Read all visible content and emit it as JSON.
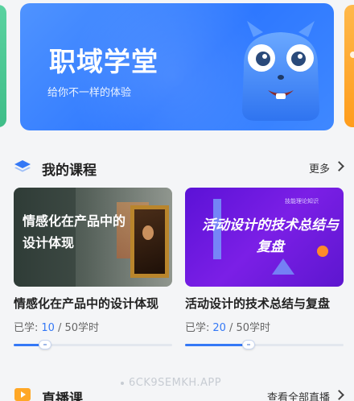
{
  "banner": {
    "title": "职域学堂",
    "subtitle": "给你不一样的体验"
  },
  "my_courses": {
    "title": "我的课程",
    "more_label": "更多",
    "icon": "layers-icon"
  },
  "courses": [
    {
      "thumb_text": "情感化在产品中的设计体现",
      "title": "情感化在产品中的设计体现",
      "progress_label": "已学:",
      "done": "10",
      "total": "/ 50学时",
      "progress_fraction": 0.2
    },
    {
      "thumb_tag": "技能理论知识",
      "thumb_text": "活动设计的技术总结与复盘",
      "title": "活动设计的技术总结与复盘",
      "progress_label": "已学:",
      "done": "20",
      "total": "/ 50学时",
      "progress_fraction": 0.4
    }
  ],
  "live": {
    "title": "直播课",
    "view_all_label": "查看全部直播",
    "icon": "live-video-icon"
  },
  "watermark": "6CK9SEMKH.APP",
  "colors": {
    "accent": "#3478f6",
    "banner": "#3b82ff",
    "live_icon": "#ffa726"
  }
}
